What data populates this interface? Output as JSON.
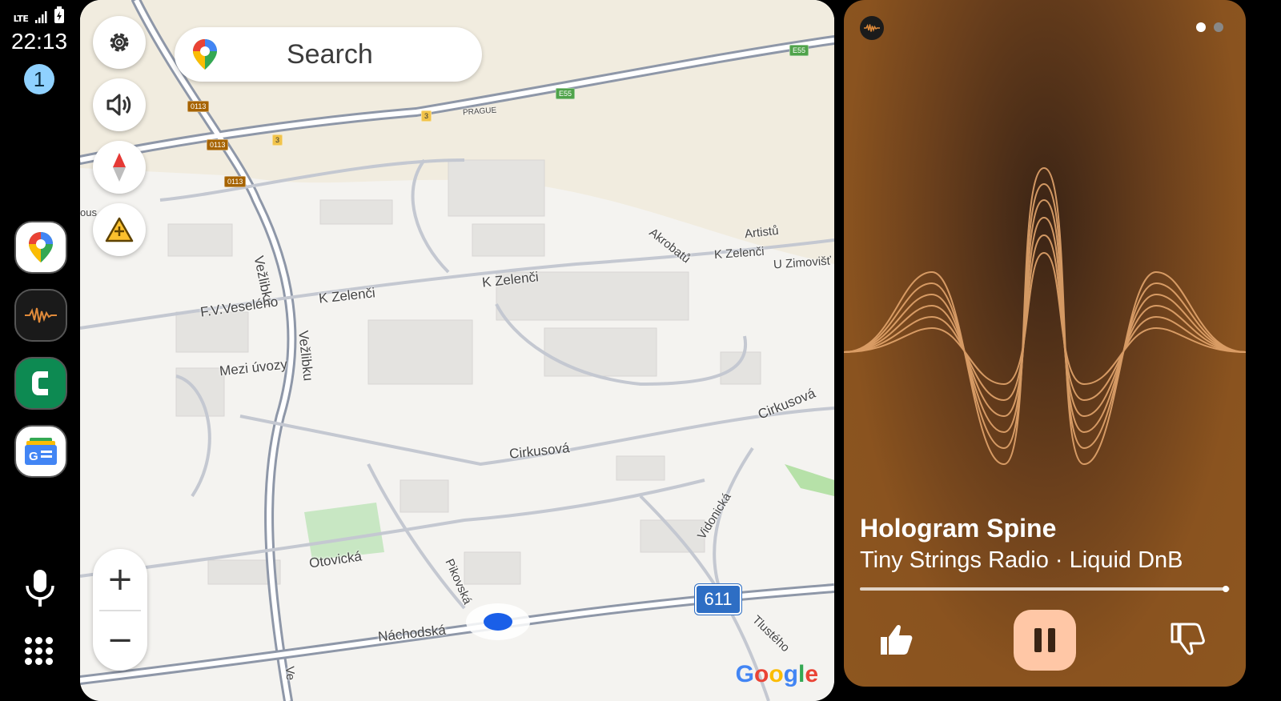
{
  "status_bar": {
    "network": "LTE",
    "time": "22:13",
    "notification_count": "1"
  },
  "rail": {
    "apps": [
      {
        "name": "Google Maps",
        "icon": "maps-pin-icon"
      },
      {
        "name": "Audio waveform app",
        "icon": "waveform-icon"
      },
      {
        "name": "Phone",
        "icon": "phone-icon"
      },
      {
        "name": "Google News",
        "icon": "news-icon"
      }
    ],
    "bottom": [
      {
        "icon": "microphone-icon"
      },
      {
        "icon": "app-grid-icon"
      }
    ]
  },
  "map": {
    "search_placeholder": "Search",
    "controls": [
      "gear-icon",
      "volume-icon",
      "compass-icon",
      "report-hazard-icon"
    ],
    "zoom_in": "+",
    "zoom_out": "−",
    "streets": [
      "Vežlibku",
      "Vežlibku",
      "F.V.Veselého",
      "K Zelenči",
      "K Zelenči",
      "K Zelenči",
      "Akrobatů",
      "Artistů",
      "U Zimovišť",
      "Mezi úvozy",
      "Cirkusová",
      "Cirkusová",
      "Otovická",
      "Pikovská",
      "Vidonická",
      "Náchodská",
      "Tlustého",
      "Ve",
      "PRAGUE",
      "ous"
    ],
    "road_signs": [
      "0113",
      "0113",
      "0113",
      "3",
      "3",
      "E55",
      "E55"
    ],
    "route_shield": "611",
    "attribution": "Google"
  },
  "media": {
    "title": "Hologram Spine",
    "subtitle": "Tiny Strings Radio · Liquid DnB",
    "progress": 0.99,
    "pager_active": 0,
    "accent": "#ffc7a6",
    "background": "#8d561f"
  }
}
